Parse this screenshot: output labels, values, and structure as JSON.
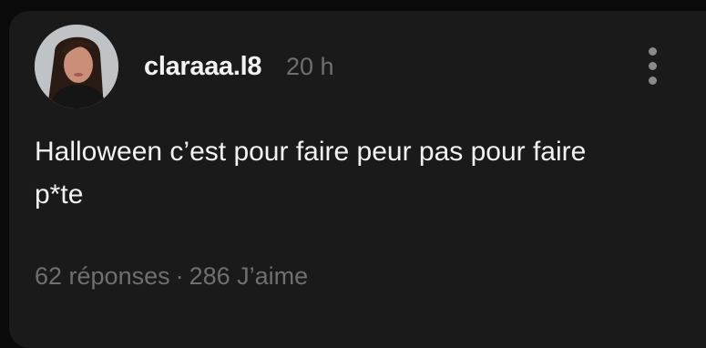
{
  "post": {
    "username": "claraaa.l8",
    "time": "20 h",
    "text_line1": "Halloween c’est pour faire peur pas pour faire",
    "text_line2": "p*te",
    "replies": "62 réponses",
    "separator": "·",
    "likes": "286 J’aime"
  },
  "icons": {
    "avatar": "profile-photo",
    "more": "vertical-ellipsis-icon"
  },
  "colors": {
    "background": "#0a0a0a",
    "card": "#1a1a1a",
    "primary_text": "#f2f2f2",
    "secondary_text": "#6f6f6f"
  }
}
